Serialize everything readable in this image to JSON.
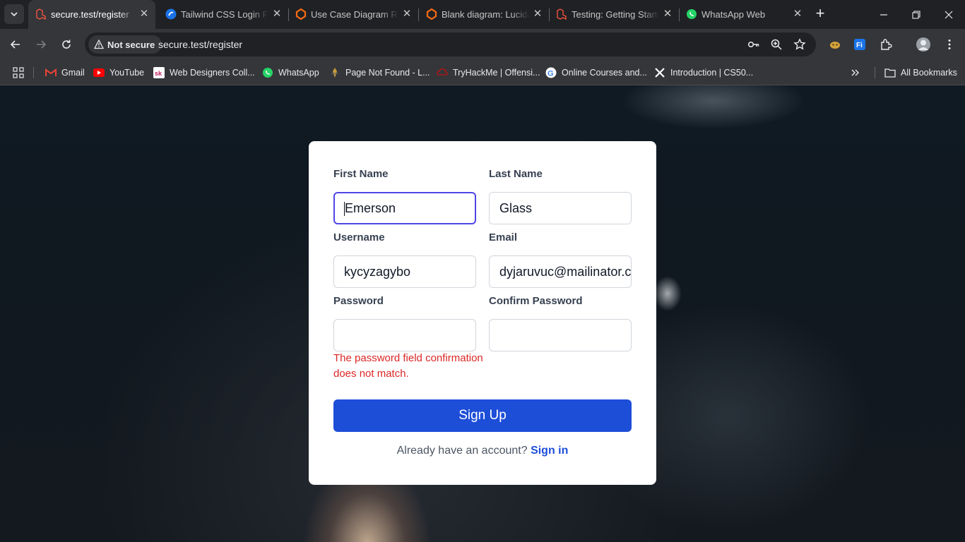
{
  "tabs": [
    {
      "title": "secure.test/register",
      "active": true,
      "favicon": "laravel-icon"
    },
    {
      "title": "Tailwind CSS Login Form",
      "active": false,
      "favicon": "tailwind-icon"
    },
    {
      "title": "Use Case Diagram Relationships",
      "active": false,
      "favicon": "lucid-icon"
    },
    {
      "title": "Blank diagram: Lucidchart",
      "active": false,
      "favicon": "lucid-icon"
    },
    {
      "title": "Testing: Getting Started",
      "active": false,
      "favicon": "laravel-icon"
    },
    {
      "title": "WhatsApp Web",
      "active": false,
      "favicon": "whatsapp-icon"
    }
  ],
  "toolbar": {
    "security_label": "Not secure",
    "url": "secure.test/register"
  },
  "bookmarks": [
    {
      "label": "Gmail",
      "icon": "gmail-icon"
    },
    {
      "label": "YouTube",
      "icon": "youtube-icon"
    },
    {
      "label": "Web Designers Coll...",
      "icon": "sk-icon"
    },
    {
      "label": "WhatsApp",
      "icon": "whatsapp-icon"
    },
    {
      "label": "Page Not Found - L...",
      "icon": "bookmark-icon"
    },
    {
      "label": "TryHackMe | Offensi...",
      "icon": "tryhackme-icon"
    },
    {
      "label": "Online Courses and...",
      "icon": "google-icon"
    },
    {
      "label": "Introduction | CS50...",
      "icon": "x-icon"
    }
  ],
  "all_bookmarks": "All Bookmarks",
  "form": {
    "first_name": {
      "label": "First Name",
      "value": "Emerson"
    },
    "last_name": {
      "label": "Last Name",
      "value": "Glass"
    },
    "username": {
      "label": "Username",
      "value": "kycyzagybo"
    },
    "email": {
      "label": "Email",
      "value": "dyjaruvuc@mailinator.com"
    },
    "password": {
      "label": "Password",
      "value": ""
    },
    "confirm_password": {
      "label": "Confirm Password",
      "value": ""
    },
    "error": "The password field confirmation does not match.",
    "submit_label": "Sign Up",
    "signin_prompt": "Already have an account?",
    "signin_link": "Sign in"
  },
  "colors": {
    "primary": "#1d4ed8",
    "error": "#dc2626",
    "focus_ring": "#4f46e5"
  }
}
